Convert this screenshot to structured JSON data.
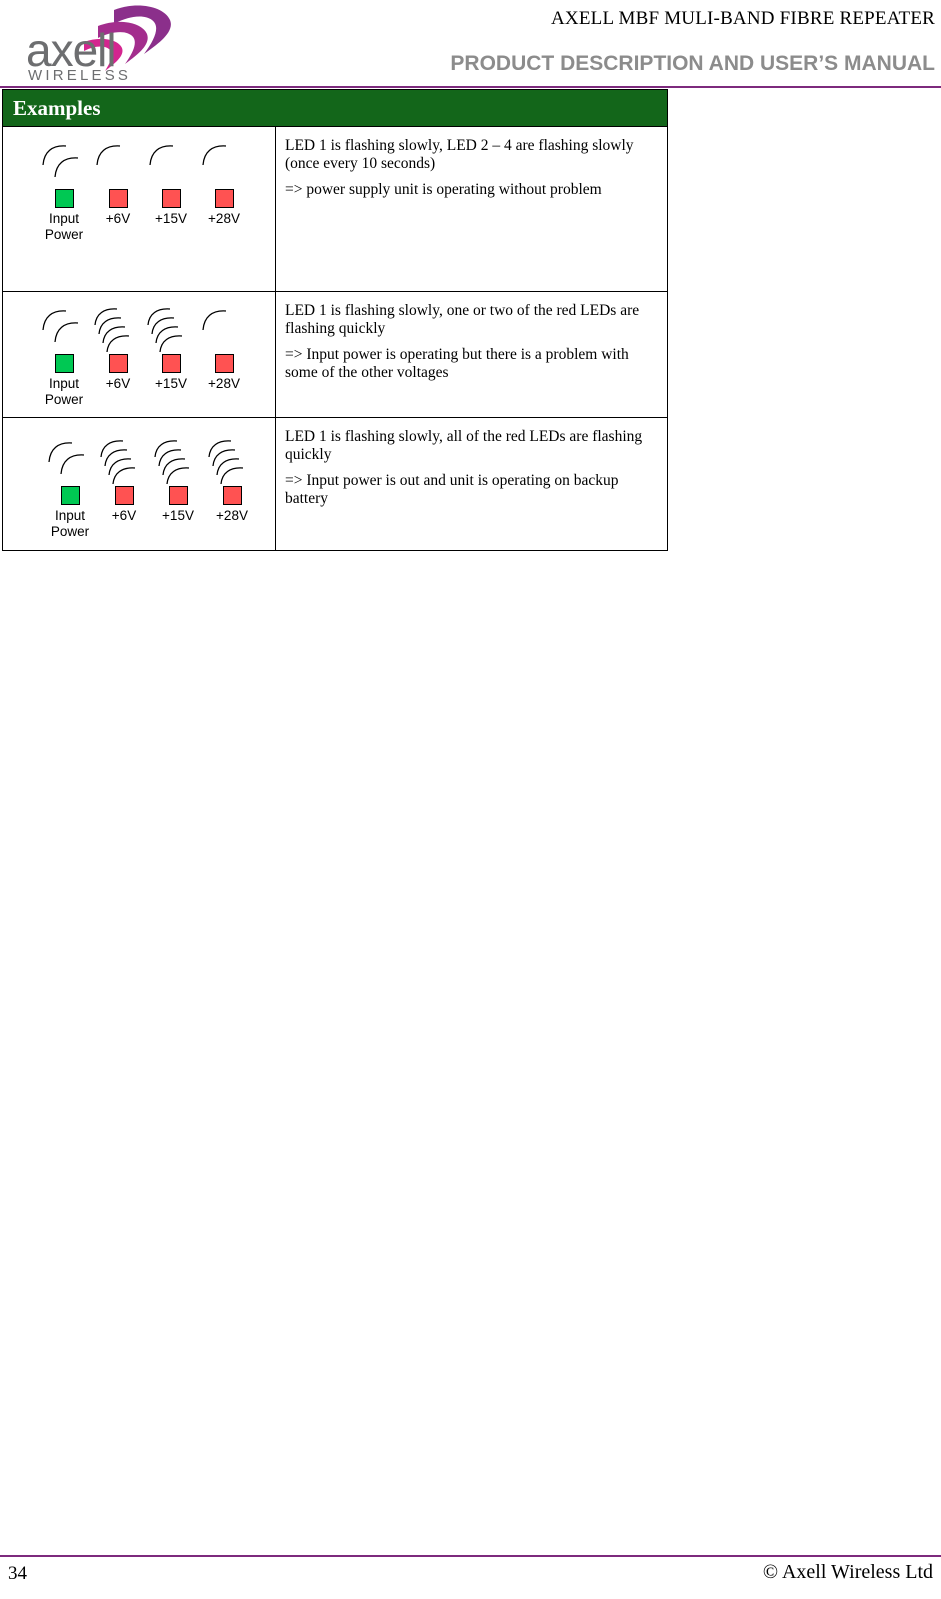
{
  "header": {
    "title_line1": "AXELL MBF MULI-BAND FIBRE REPEATER",
    "title_line2": "PRODUCT DESCRIPTION AND USER’S MANUAL",
    "logo_wordmark": "axell",
    "logo_subtext": "WIRELESS",
    "rule_color": "#7d2a7d"
  },
  "table": {
    "header_label": "Examples",
    "header_bg": "#13661a",
    "rows": [
      {
        "leds": [
          {
            "name": "Input\nPower",
            "label": "Input\nPower",
            "color": "green",
            "color_hex": "#00c853",
            "waves": 2
          },
          {
            "name": "+6V",
            "label": "+6V",
            "color": "red",
            "color_hex": "#ff5252",
            "waves": 1
          },
          {
            "name": "+15V",
            "label": "+15V",
            "color": "red",
            "color_hex": "#ff5252",
            "waves": 1
          },
          {
            "name": "+28V",
            "label": "+28V",
            "color": "red",
            "color_hex": "#ff5252",
            "waves": 1
          }
        ],
        "description": [
          "LED 1 is flashing slowly, LED 2 – 4 are flashing slowly (once every 10 seconds)",
          "=> power supply unit is operating without problem"
        ]
      },
      {
        "leds": [
          {
            "name": "Input\nPower",
            "label": "Input\nPower",
            "color": "green",
            "color_hex": "#00c853",
            "waves": 2
          },
          {
            "name": "+6V",
            "label": "+6V",
            "color": "red",
            "color_hex": "#ff5252",
            "waves": 4
          },
          {
            "name": "+15V",
            "label": "+15V",
            "color": "red",
            "color_hex": "#ff5252",
            "waves": 4
          },
          {
            "name": "+28V",
            "label": "+28V",
            "color": "red",
            "color_hex": "#ff5252",
            "waves": 1
          }
        ],
        "description": [
          "LED 1 is flashing slowly, one or two of  the red LEDs are flashing quickly",
          "=> Input power is operating but there is a problem with some of the other voltages"
        ]
      },
      {
        "leds": [
          {
            "name": "Input\nPower",
            "label": "Input\nPower",
            "color": "green",
            "color_hex": "#00c853",
            "waves": 2
          },
          {
            "name": "+6V",
            "label": "+6V",
            "color": "red",
            "color_hex": "#ff5252",
            "waves": 4
          },
          {
            "name": "+15V",
            "label": "+15V",
            "color": "red",
            "color_hex": "#ff5252",
            "waves": 4
          },
          {
            "name": "+28V",
            "label": "+28V",
            "color": "red",
            "color_hex": "#ff5252",
            "waves": 4
          }
        ],
        "description": [
          "LED 1 is flashing slowly, all of  the red LEDs are flashing quickly",
          "=> Input power is out and unit is operating on backup battery"
        ]
      }
    ]
  },
  "footer": {
    "page_number": "34",
    "copyright": "© Axell Wireless Ltd",
    "rule_color": "#7d2a7d"
  }
}
